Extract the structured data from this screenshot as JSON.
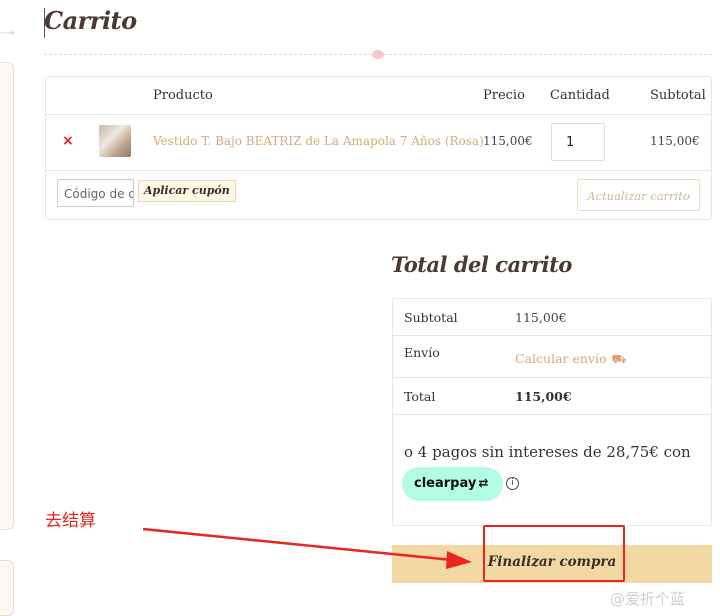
{
  "page": {
    "title": "Carrito"
  },
  "cart": {
    "headers": {
      "product": "Producto",
      "price": "Precio",
      "quantity": "Cantidad",
      "subtotal": "Subtotal"
    },
    "item": {
      "remove_symbol": "×",
      "name": "Vestido T. Bajo BEATRIZ de La Amapola 7 Años (Rosa)",
      "price": "115,00€",
      "quantity": "1",
      "subtotal": "115,00€"
    },
    "coupon_placeholder": "Código de cupón",
    "apply_coupon_label": "Aplicar cupón",
    "update_cart_label": "Actualizar carrito"
  },
  "totals": {
    "title": "Total del carrito",
    "subtotal_label": "Subtotal",
    "subtotal_value": "115,00€",
    "shipping_label": "Envío",
    "shipping_link": "Calcular envío",
    "total_label": "Total",
    "total_value": "115,00€",
    "installments_text": "o 4 pagos sin intereses de 28,75€ con",
    "clearpay_label": "clearpay",
    "checkout_label": "Finalizar compra"
  },
  "annotation": {
    "label": "去结算",
    "color": "#e8261f"
  },
  "watermark": "@爱折个蓝",
  "icons": {
    "remove": "close-icon",
    "shipping": "truck-icon",
    "clearpay": "clearpay-arrows-icon",
    "info": "info-icon"
  },
  "colors": {
    "accent_link": "#d8a878",
    "checkout_bg": "#f4d8a4",
    "clearpay_bg": "#b2fce4",
    "remove": "#e02020"
  }
}
